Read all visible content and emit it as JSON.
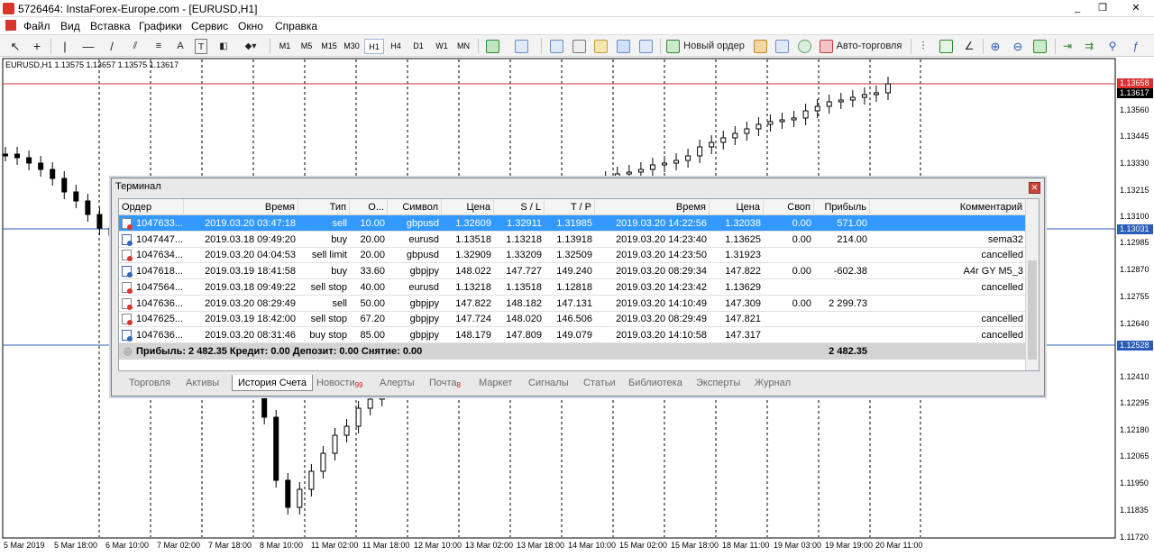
{
  "window": {
    "title": "5726464: InstaForex-Europe.com - [EURUSD,H1]",
    "buttons": [
      "_",
      "❐",
      "✕"
    ]
  },
  "menu": [
    "Файл",
    "Вид",
    "Вставка",
    "Графики",
    "Сервис",
    "Окно",
    "Справка"
  ],
  "toolbar": {
    "timeframes": [
      "M1",
      "M5",
      "M15",
      "M30",
      "H1",
      "H4",
      "D1",
      "W1",
      "MN"
    ],
    "selected_timeframe": "H1",
    "new_order_label": "Новый ордер",
    "autotrade_label": "Авто-торговля"
  },
  "chart": {
    "symbol_info": "EURUSD,H1  1.13575 1.13657 1.13575 1.13617",
    "price_labels": [
      "1.13560",
      "1.13445",
      "1.13330",
      "1.13215",
      "1.13100",
      "1.12985",
      "1.12870",
      "1.12755",
      "1.12640",
      "1.12410",
      "1.12295",
      "1.12180",
      "1.12065",
      "1.11950",
      "1.11835",
      "1.11720"
    ],
    "price_markers": [
      {
        "value": "1.13658",
        "color": "#d93030"
      },
      {
        "value": "1.13617",
        "color": "#000000"
      },
      {
        "value": "1.13031",
        "color": "#2b5cb8"
      },
      {
        "value": "1.12528",
        "color": "#2b5cb8"
      }
    ],
    "time_labels": [
      "5 Mar 2019",
      "5 Mar 18:00",
      "6 Mar 10:00",
      "7 Mar 02:00",
      "7 Mar 18:00",
      "8 Mar 10:00",
      "11 Mar 02:00",
      "11 Mar 18:00",
      "12 Mar 10:00",
      "13 Mar 02:00",
      "13 Mar 18:00",
      "14 Mar 10:00",
      "15 Mar 02:00",
      "15 Mar 18:00",
      "18 Mar 11:00",
      "19 Mar 03:00",
      "19 Mar 19:00",
      "20 Mar 11:00"
    ]
  },
  "terminal": {
    "title": "Терминал",
    "columns": [
      "Ордер",
      "Время",
      "Тип",
      "О...",
      "Символ",
      "Цена",
      "S / L",
      "T / P",
      "Время",
      "Цена",
      "Своп",
      "Прибыль",
      "Комментарий"
    ],
    "rows": [
      {
        "order": "1047633...",
        "open_time": "2019.03.20 03:47:18",
        "type": "sell",
        "volume": "10.00",
        "symbol": "gbpusd",
        "price": "1.32609",
        "sl": "1.32911",
        "tp": "1.31985",
        "close_time": "2019.03.20 14:22:56",
        "close_price": "1.32038",
        "swap": "0.00",
        "profit": "571.00",
        "comment": "",
        "icon": "red",
        "selected": true
      },
      {
        "order": "1047447...",
        "open_time": "2019.03.18 09:49:20",
        "type": "buy",
        "volume": "20.00",
        "symbol": "eurusd",
        "price": "1.13518",
        "sl": "1.13218",
        "tp": "1.13918",
        "close_time": "2019.03.20 14:23:40",
        "close_price": "1.13625",
        "swap": "0.00",
        "profit": "214.00",
        "comment": "sema32",
        "icon": "blue",
        "selected": false
      },
      {
        "order": "1047634...",
        "open_time": "2019.03.20 04:04:53",
        "type": "sell limit",
        "volume": "20.00",
        "symbol": "gbpusd",
        "price": "1.32909",
        "sl": "1.33209",
        "tp": "1.32509",
        "close_time": "2019.03.20 14:23:50",
        "close_price": "1.31923",
        "swap": "",
        "profit": "",
        "comment": "cancelled",
        "icon": "red",
        "selected": false
      },
      {
        "order": "1047618...",
        "open_time": "2019.03.19 18:41:58",
        "type": "buy",
        "volume": "33.60",
        "symbol": "gbpjpy",
        "price": "148.022",
        "sl": "147.727",
        "tp": "149.240",
        "close_time": "2019.03.20 08:29:34",
        "close_price": "147.822",
        "swap": "0.00",
        "profit": "-602.38",
        "comment": "A4r GY M5_3",
        "icon": "blue",
        "selected": false
      },
      {
        "order": "1047564...",
        "open_time": "2019.03.18 09:49:22",
        "type": "sell stop",
        "volume": "40.00",
        "symbol": "eurusd",
        "price": "1.13218",
        "sl": "1.13518",
        "tp": "1.12818",
        "close_time": "2019.03.20 14:23:42",
        "close_price": "1.13629",
        "swap": "",
        "profit": "",
        "comment": "cancelled",
        "icon": "red",
        "selected": false
      },
      {
        "order": "1047636...",
        "open_time": "2019.03.20 08:29:49",
        "type": "sell",
        "volume": "50.00",
        "symbol": "gbpjpy",
        "price": "147.822",
        "sl": "148.182",
        "tp": "147.131",
        "close_time": "2019.03.20 14:10:49",
        "close_price": "147.309",
        "swap": "0.00",
        "profit": "2 299.73",
        "comment": "",
        "icon": "red",
        "selected": false
      },
      {
        "order": "1047625...",
        "open_time": "2019.03.19 18:42:00",
        "type": "sell stop",
        "volume": "67.20",
        "symbol": "gbpjpy",
        "price": "147.724",
        "sl": "148.020",
        "tp": "146.506",
        "close_time": "2019.03.20 08:29:49",
        "close_price": "147.821",
        "swap": "",
        "profit": "",
        "comment": "cancelled",
        "icon": "red",
        "selected": false
      },
      {
        "order": "1047636...",
        "open_time": "2019.03.20 08:31:46",
        "type": "buy stop",
        "volume": "85.00",
        "symbol": "gbpjpy",
        "price": "148.179",
        "sl": "147.809",
        "tp": "149.079",
        "close_time": "2019.03.20 14:10:58",
        "close_price": "147.317",
        "swap": "",
        "profit": "",
        "comment": "cancelled",
        "icon": "blue",
        "selected": false
      }
    ],
    "summary": {
      "text": "Прибыль: 2 482.35  Кредит: 0.00  Депозит: 0.00  Снятие: 0.00",
      "total": "2 482.35"
    },
    "tabs": [
      {
        "label": "Торговля",
        "badge": ""
      },
      {
        "label": "Активы",
        "badge": ""
      },
      {
        "label": "История Счета",
        "badge": "",
        "active": true
      },
      {
        "label": "Новости",
        "badge": "99"
      },
      {
        "label": "Алерты",
        "badge": ""
      },
      {
        "label": "Почта",
        "badge": "8"
      },
      {
        "label": "Маркет",
        "badge": ""
      },
      {
        "label": "Сигналы",
        "badge": ""
      },
      {
        "label": "Статьи",
        "badge": ""
      },
      {
        "label": "Библиотека",
        "badge": ""
      },
      {
        "label": "Эксперты",
        "badge": ""
      },
      {
        "label": "Журнал",
        "badge": ""
      }
    ]
  }
}
